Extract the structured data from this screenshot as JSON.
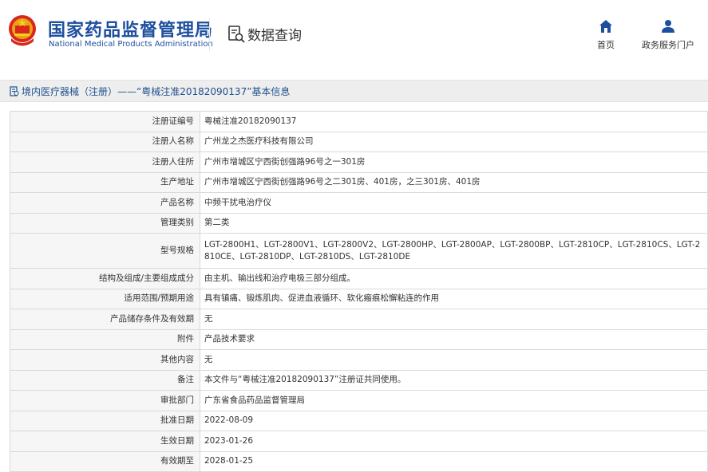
{
  "header": {
    "title_cn": "国家药品监督管理局",
    "title_en": "National Medical Products Administration",
    "query_label": "数据查询",
    "nav": [
      {
        "label": "首页",
        "icon": "home-icon"
      },
      {
        "label": "政务服务门户",
        "icon": "user-icon"
      }
    ]
  },
  "breadcrumb": {
    "text": "境内医疗器械（注册）——“粤械注准20182090137”基本信息",
    "icon": "document-icon"
  },
  "detail": {
    "rows": [
      {
        "label": "注册证编号",
        "value": "粤械注准20182090137"
      },
      {
        "label": "注册人名称",
        "value": "广州龙之杰医疗科技有限公司"
      },
      {
        "label": "注册人住所",
        "value": "广州市增城区宁西街创强路96号之一301房"
      },
      {
        "label": "生产地址",
        "value": "广州市增城区宁西街创强路96号之二301房、401房，之三301房、401房"
      },
      {
        "label": "产品名称",
        "value": "中频干扰电治疗仪"
      },
      {
        "label": "管理类别",
        "value": "第二类"
      },
      {
        "label": "型号规格",
        "value": "LGT-2800H1、LGT-2800V1、LGT-2800V2、LGT-2800HP、LGT-2800AP、LGT-2800BP、LGT-2810CP、LGT-2810CS、LGT-2810CE、LGT-2810DP、LGT-2810DS、LGT-2810DE"
      },
      {
        "label": "结构及组成/主要组成成分",
        "value": "由主机、输出线和治疗电极三部分组成。"
      },
      {
        "label": "适用范围/预期用途",
        "value": "具有镇痛、锻炼肌肉、促进血液循环、软化瘢痕松懈粘连的作用"
      },
      {
        "label": "产品储存条件及有效期",
        "value": "无"
      },
      {
        "label": "附件",
        "value": "产品技术要求"
      },
      {
        "label": "其他内容",
        "value": "无"
      },
      {
        "label": "备注",
        "value": "本文件与“粤械注准20182090137”注册证共同使用。"
      },
      {
        "label": "审批部门",
        "value": "广东省食品药品监督管理局"
      },
      {
        "label": "批准日期",
        "value": "2022-08-09"
      },
      {
        "label": "生效日期",
        "value": "2023-01-26"
      },
      {
        "label": "有效期至",
        "value": "2028-01-25"
      }
    ]
  },
  "colors": {
    "brand_blue": "#1d4f9e",
    "label_bg": "#f6f6f6",
    "border": "#d9d9d9",
    "breadcrumb_bg": "#eeeeee"
  }
}
